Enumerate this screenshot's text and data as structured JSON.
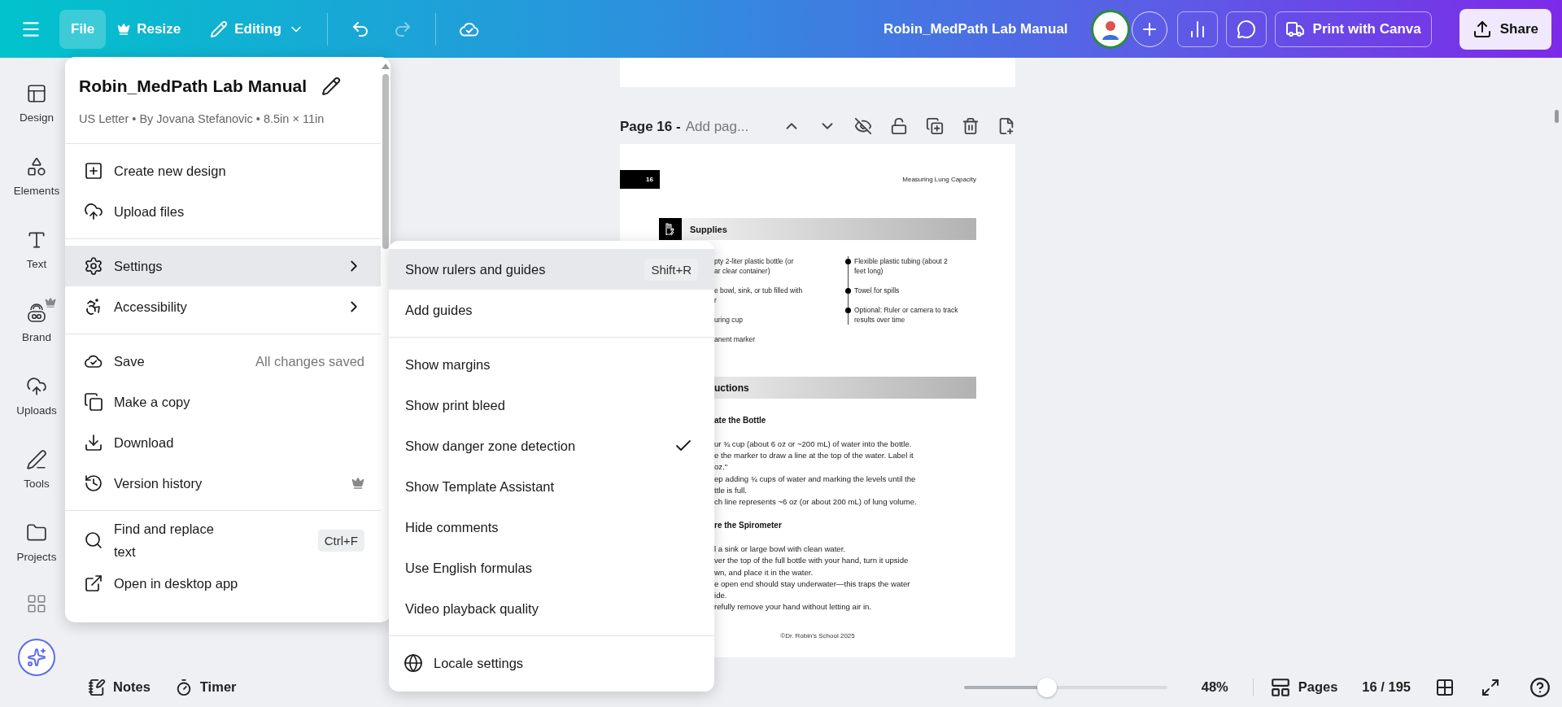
{
  "topbar": {
    "file_button": {
      "label": "File",
      "open": true
    },
    "resize_button": "Resize",
    "editing_button": "Editing",
    "undo": {
      "disabled": false
    },
    "redo": {
      "disabled": true
    },
    "title": "Robin_MedPath Lab Manual",
    "print_button": "Print with Canva",
    "share_button": "Share"
  },
  "sidebar": {
    "items": [
      {
        "label": "Design",
        "premium": false
      },
      {
        "label": "Elements",
        "premium": false
      },
      {
        "label": "Text",
        "premium": false
      },
      {
        "label": "Brand",
        "premium": true
      },
      {
        "label": "Uploads",
        "premium": false
      },
      {
        "label": "Tools",
        "premium": false
      },
      {
        "label": "Projects",
        "premium": false
      }
    ]
  },
  "file_menu": {
    "title": "Robin_MedPath Lab Manual",
    "subtitle": "US Letter • By Jovana Stefanovic • 8.5in × 11in",
    "groups": [
      [
        {
          "label": "Create new design",
          "selected": false,
          "submenu": false,
          "premium": false
        },
        {
          "label": "Upload files",
          "selected": false,
          "submenu": false,
          "premium": false
        }
      ],
      [
        {
          "label": "Settings",
          "selected": true,
          "submenu": true,
          "premium": false
        },
        {
          "label": "Accessibility",
          "selected": false,
          "submenu": true,
          "premium": false
        }
      ],
      [
        {
          "label": "Save",
          "hint": "All changes saved",
          "selected": false,
          "submenu": false,
          "premium": false
        },
        {
          "label": "Make a copy",
          "selected": false,
          "submenu": false,
          "premium": false
        },
        {
          "label": "Download",
          "selected": false,
          "submenu": false,
          "premium": false
        },
        {
          "label": "Version history",
          "selected": false,
          "submenu": false,
          "premium": true
        }
      ],
      [
        {
          "label": "Find and replace text",
          "shortcut": "Ctrl+F",
          "selected": false,
          "submenu": false,
          "premium": false
        },
        {
          "label": "Open in desktop app",
          "selected": false,
          "submenu": false,
          "premium": false
        }
      ]
    ]
  },
  "settings_menu": {
    "groups": [
      [
        {
          "label": "Show rulers and guides",
          "shortcut": "Shift+R",
          "selected": true,
          "checked": false
        },
        {
          "label": "Add guides",
          "selected": false,
          "checked": false
        }
      ],
      [
        {
          "label": "Show margins",
          "selected": false,
          "checked": false
        },
        {
          "label": "Show print bleed",
          "selected": false,
          "checked": false
        },
        {
          "label": "Show danger zone detection",
          "selected": false,
          "checked": true
        },
        {
          "label": "Show Template Assistant",
          "selected": false,
          "checked": false
        },
        {
          "label": "Hide comments",
          "selected": false,
          "checked": false
        },
        {
          "label": "Use English formulas",
          "selected": false,
          "checked": false
        },
        {
          "label": "Video playback quality",
          "selected": false,
          "checked": false
        }
      ],
      [
        {
          "label": "Locale settings",
          "selected": false,
          "checked": false
        }
      ]
    ]
  },
  "page_header": {
    "title": "Page 16 -",
    "placeholder": "Add pag..."
  },
  "document": {
    "page_number": "16",
    "running_head": "Measuring Lung Capacity",
    "supplies": {
      "heading": "Supplies",
      "left": [
        [
          "pty 2-liter plastic bottle (or",
          "ar clear container)"
        ],
        [
          "e bowl, sink, or tub filled with",
          "r"
        ],
        [
          "uring cup"
        ],
        [
          "anent marker"
        ]
      ],
      "right": [
        [
          "Flexible plastic tubing (about 2",
          "feet long)"
        ],
        [
          "Towel for spills"
        ],
        [
          "Optional: Ruler or camera to track",
          "results over time"
        ]
      ]
    },
    "instructions": {
      "heading": "uctions",
      "steps": [
        {
          "title": "ate the Bottle",
          "lines": [
            "ur ¾ cup (about 6 oz or ~200 mL) of water into the bottle.",
            "e the marker to draw a line at the top of the water. Label it",
            "oz.\"",
            "ep adding ¾ cups of water and marking the levels until the",
            "ttle is full.",
            "ch line represents ~6 oz (or about 200 mL) of lung volume."
          ]
        },
        {
          "title": "re the Spirometer",
          "lines": [
            "l a sink or large bowl with clean water.",
            "ver the top of the full bottle with your hand, turn it upside",
            "wn, and place it in the water.",
            "e open end should stay underwater—this traps the water",
            "ide.",
            "refully remove your hand without letting air in."
          ]
        }
      ]
    },
    "footer": "©Dr. Robin's School 2025"
  },
  "bottom_bar": {
    "notes": "Notes",
    "timer": "Timer",
    "zoom": {
      "level": 0.41,
      "reading": "48%"
    },
    "pages": "Pages",
    "page_count": "16 / 195"
  }
}
